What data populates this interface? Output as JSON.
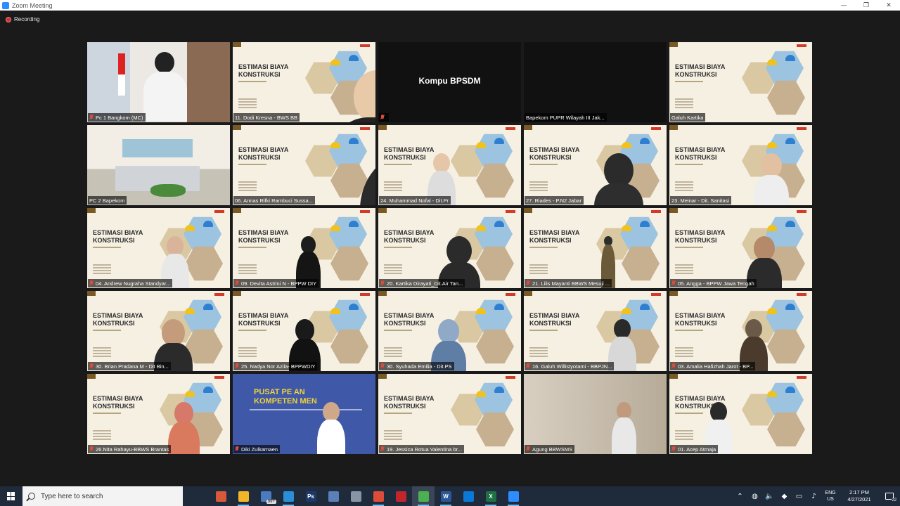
{
  "window": {
    "title": "Zoom Meeting",
    "controls": {
      "minimize": "—",
      "restore": "❐",
      "close": "✕"
    }
  },
  "recording": {
    "label": "Recording"
  },
  "slide": {
    "line1": "ESTIMASI BIAYA",
    "line2": "KONSTRUKSI"
  },
  "dark_tile_text": "Kompu BPSDM",
  "pusat_title": {
    "line1": "PUSAT PE        AN",
    "line2": "KOMPETEN         MEN"
  },
  "participants": [
    {
      "name": "Pc 1 Bangkom (MC)",
      "muted": true
    },
    {
      "name": "11. Dodi Kresna - BWS BB",
      "muted": false
    },
    {
      "name": "",
      "muted": true
    },
    {
      "name": "Bapekom PUPR Wilayah III Jak...",
      "muted": false
    },
    {
      "name": "Galuh Kartika",
      "muted": false
    },
    {
      "name": "PC 2 Bapekom",
      "muted": false
    },
    {
      "name": "06. Annas Rifki Rambuci Sussa...",
      "muted": false
    },
    {
      "name": "24. Muhammad Nofal - Dit.Pr",
      "muted": false
    },
    {
      "name": "27. Riades - P.N2 Jabar",
      "muted": false
    },
    {
      "name": "23. Meinar - Dit. Sanitasi",
      "muted": false
    },
    {
      "name": "04. Andrew Nugraha Standyar...",
      "muted": true
    },
    {
      "name": "09. Devita Astrini N - BPPW DIY",
      "muted": true
    },
    {
      "name": "20. Kartika Dirayati_Dit.Air Tan...",
      "muted": true
    },
    {
      "name": "21. Lilis Mayanti BBWS Mesuji ...",
      "muted": true
    },
    {
      "name": "05. Angga - BPPW Jawa Tengah",
      "muted": true
    },
    {
      "name": "30. Brian Pradana M - Dit Bin...",
      "muted": true
    },
    {
      "name": "25. Nadya Nor Azila- BPPWDIY",
      "muted": true
    },
    {
      "name": "30. Syuhada Emilia - Dit.PS",
      "muted": true
    },
    {
      "name": "16. Galuh Willistyotami - BBPJN...",
      "muted": true
    },
    {
      "name": "03. Amalia Hafizhah Jarot - BP...",
      "muted": true
    },
    {
      "name": "26.Nita Rahayu-BBWS Brantas",
      "muted": true
    },
    {
      "name": "Diki Zulkarnaen",
      "muted": true
    },
    {
      "name": "19. Jessica Rotua Valentina br...",
      "muted": true
    },
    {
      "name": "Agung BBWSMS",
      "muted": true
    },
    {
      "name": "01. Acep Atmaja",
      "muted": true
    }
  ],
  "taskbar": {
    "search_placeholder": "Type here to search",
    "badge": "99+",
    "apps": [
      {
        "icon": "task-view-icon",
        "color": "#1f2a3a"
      },
      {
        "icon": "pen-icon",
        "color": "#d8583a"
      },
      {
        "icon": "file-explorer-icon",
        "color": "#f2b529"
      },
      {
        "icon": "mail-icon",
        "color": "#4a7bbf"
      },
      {
        "icon": "edge-icon",
        "color": "#2a8fd8"
      },
      {
        "icon": "photoshop-icon",
        "color": "#1b3a6b",
        "label": "Ps"
      },
      {
        "icon": "monitor-icon",
        "color": "#5b7fb8"
      },
      {
        "icon": "cloud-icon",
        "color": "#8894a6"
      },
      {
        "icon": "chrome-icon",
        "color": "#dd4b39"
      },
      {
        "icon": "acrobat-icon",
        "color": "#c2252b"
      },
      {
        "icon": "chrome-profile-icon",
        "color": "#4caf50"
      },
      {
        "icon": "word-icon",
        "color": "#2b5797",
        "label": "W"
      },
      {
        "icon": "photos-icon",
        "color": "#0a78d4"
      },
      {
        "icon": "excel-icon",
        "color": "#1e7145",
        "label": "X"
      },
      {
        "icon": "zoom-icon",
        "color": "#2d8cff"
      }
    ],
    "lang": {
      "line1": "ENG",
      "line2": "US"
    },
    "time": "2:17 PM",
    "date": "4/27/2021",
    "notifications": "22"
  }
}
